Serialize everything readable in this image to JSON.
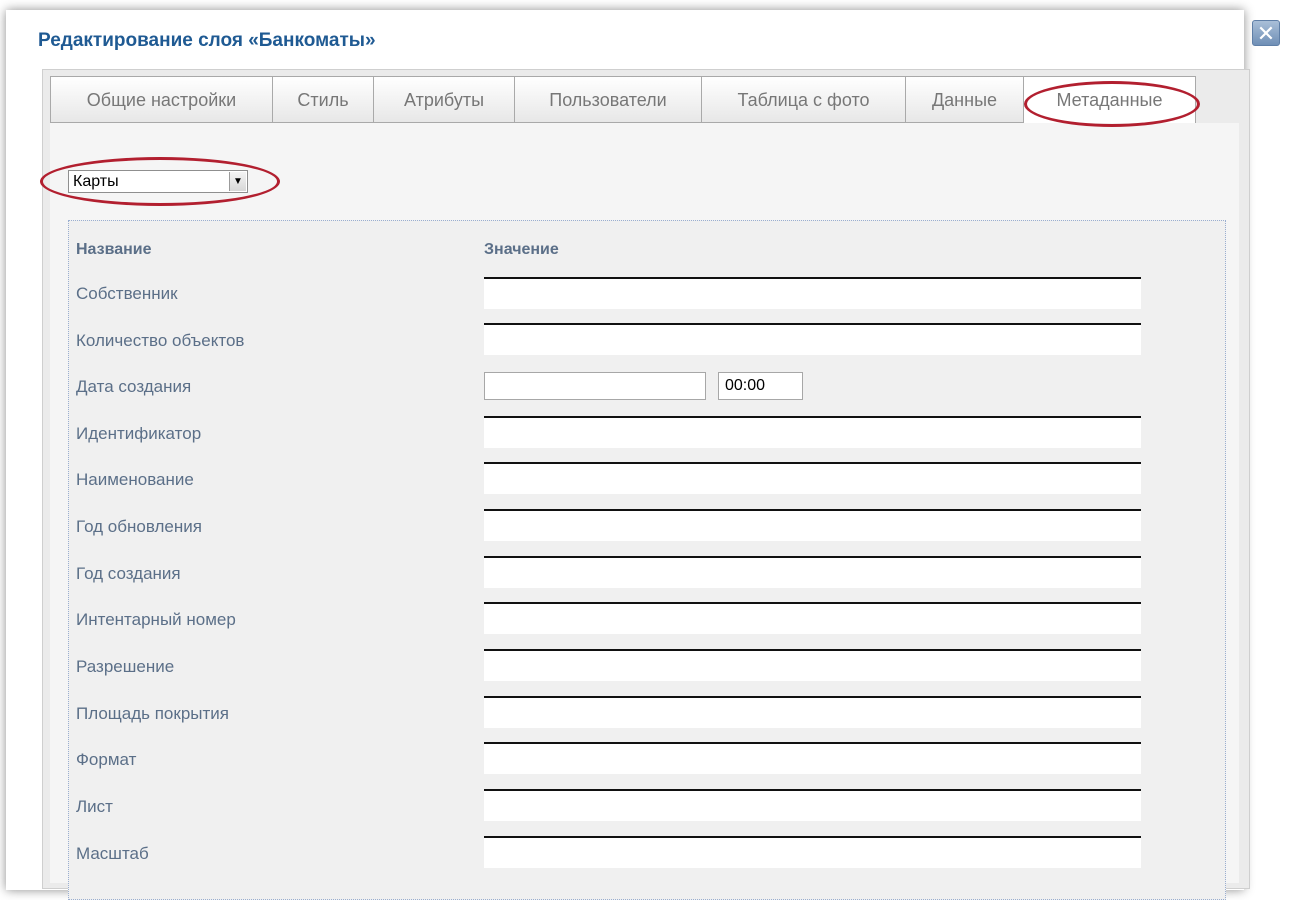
{
  "dialog": {
    "title": "Редактирование слоя «Банкоматы»",
    "close_glyph": "✕"
  },
  "tabs": [
    {
      "label": "Общие настройки"
    },
    {
      "label": "Стиль"
    },
    {
      "label": "Атрибуты"
    },
    {
      "label": "Пользователи"
    },
    {
      "label": "Таблица с фото"
    },
    {
      "label": "Данные"
    },
    {
      "label": "Метаданные",
      "active": true
    }
  ],
  "template_select": {
    "value": "Карты",
    "arrow": "▼"
  },
  "table": {
    "name_header": "Название",
    "value_header": "Значение",
    "rows": [
      {
        "label": "Собственник"
      },
      {
        "label": "Количество объектов"
      },
      {
        "label": "Дата создания",
        "time_value": "00:00"
      },
      {
        "label": "Идентификатор"
      },
      {
        "label": "Наименование"
      },
      {
        "label": "Год обновления"
      },
      {
        "label": "Год создания"
      },
      {
        "label": "Интентарный номер"
      },
      {
        "label": "Разрешение"
      },
      {
        "label": "Площадь покрытия"
      },
      {
        "label": "Формат"
      },
      {
        "label": "Лист"
      },
      {
        "label": "Масштаб"
      }
    ]
  },
  "colors": {
    "title": "#1f5a93",
    "labels": "#5b6f88",
    "annotation": "#b21f2f"
  }
}
